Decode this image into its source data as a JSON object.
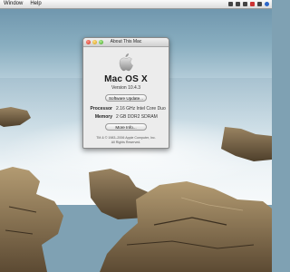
{
  "menubar": {
    "items": [
      "Window",
      "Help"
    ]
  },
  "about_window": {
    "title": "About This Mac",
    "os_name": "Mac OS X",
    "version": "Version 10.4.3",
    "software_update_label": "Software Update...",
    "processor_label": "Processor",
    "processor_value": "2.16 GHz Intel Core Duo",
    "memory_label": "Memory",
    "memory_value": "2 GB DDR2 SDRAM",
    "more_info_label": "More Info...",
    "copyright_line1": "TM & © 1983–2006 Apple Computer, Inc.",
    "copyright_line2": "All Rights Reserved."
  },
  "colors": {
    "window_bg": "#ececec",
    "menubar_bg": "#e6e6e6",
    "sky": "#6f96ad",
    "rock": "#7a6648"
  }
}
